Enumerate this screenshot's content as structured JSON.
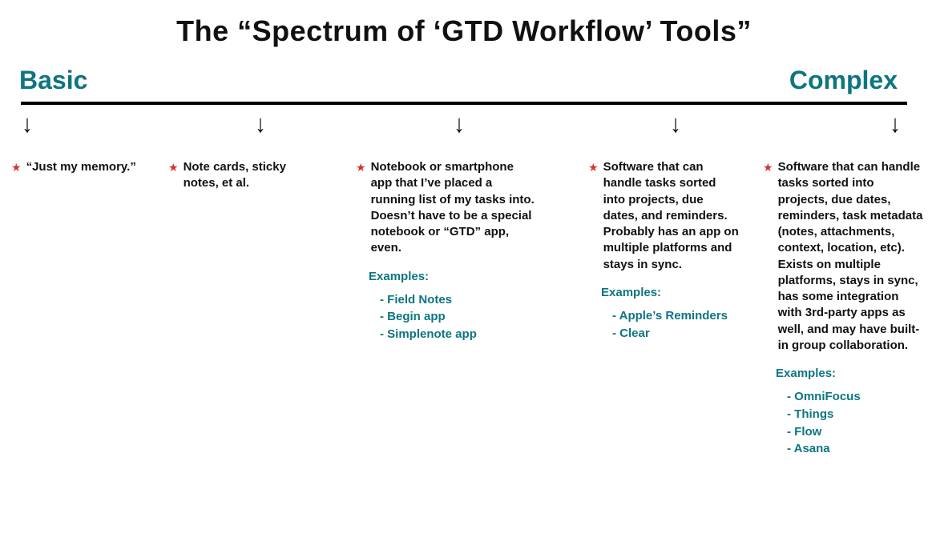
{
  "title": "The “Spectrum of ‘GTD Workflow’ Tools”",
  "axis": {
    "left": "Basic",
    "right": "Complex"
  },
  "examples_label": "Examples:",
  "columns": [
    {
      "desc": "“Just my memory.”",
      "examples": []
    },
    {
      "desc": "Note cards, sticky notes, et al.",
      "examples": []
    },
    {
      "desc": "Notebook or smartphone app that I’ve placed a running list of my tasks into. Doesn’t have to be a special notebook or “GTD” app, even.",
      "examples": [
        "Field Notes",
        "Begin app",
        "Simplenote app"
      ]
    },
    {
      "desc": "Software that can handle tasks sorted into projects, due dates, and reminders. Probably has an app on multiple platforms and stays in sync.",
      "examples": [
        "Apple’s Reminders",
        "Clear"
      ]
    },
    {
      "desc": "Software that can handle tasks sorted into projects, due dates, reminders, task metadata (notes, attachments, context, location, etc). Exists on multiple platforms, stays in sync, has some integration with 3rd-party apps as well, and may have built-in group collaboration.",
      "examples": [
        "OmniFocus",
        "Things",
        "Flow",
        "Asana"
      ]
    }
  ]
}
